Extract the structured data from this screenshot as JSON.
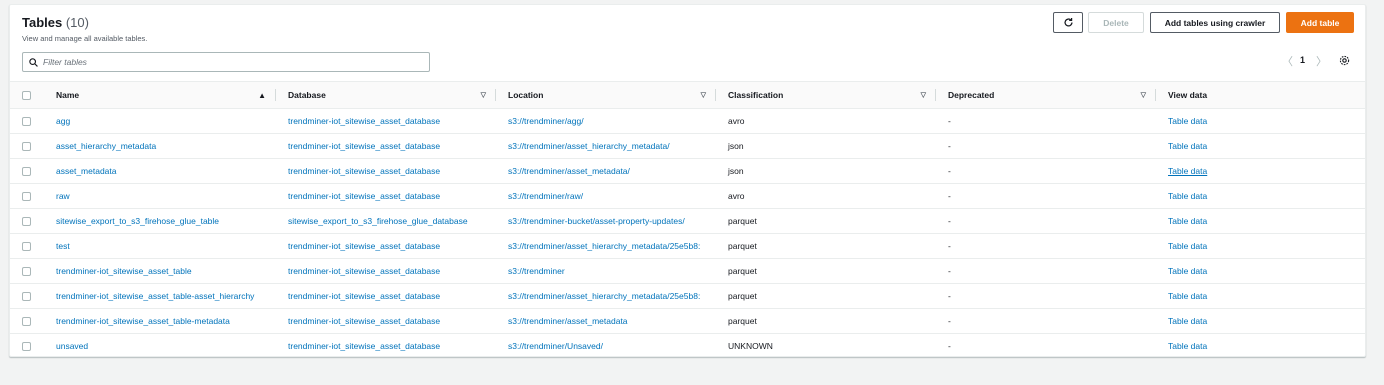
{
  "header": {
    "title": "Tables",
    "count": "(10)",
    "description": "View and manage all available tables."
  },
  "actions": {
    "delete_label": "Delete",
    "crawler_label": "Add tables using crawler",
    "add_label": "Add table"
  },
  "filter": {
    "placeholder": "Filter tables"
  },
  "pagination": {
    "prev": "〈",
    "current_page": "1",
    "next": "〉"
  },
  "columns": [
    {
      "label": "Name",
      "sort": "▲"
    },
    {
      "label": "Database",
      "sort": "▽"
    },
    {
      "label": "Location",
      "sort": "▽"
    },
    {
      "label": "Classification",
      "sort": "▽"
    },
    {
      "label": "Deprecated",
      "sort": "▽"
    },
    {
      "label": "View data",
      "sort": ""
    }
  ],
  "rows": [
    {
      "name": "agg",
      "database": "trendminer-iot_sitewise_asset_database",
      "location": "s3://trendminer/agg/",
      "classification": "avro",
      "deprecated": "-",
      "view": "Table data"
    },
    {
      "name": "asset_hierarchy_metadata",
      "database": "trendminer-iot_sitewise_asset_database",
      "location": "s3://trendminer/asset_hierarchy_metadata/",
      "classification": "json",
      "deprecated": "-",
      "view": "Table data"
    },
    {
      "name": "asset_metadata",
      "database": "trendminer-iot_sitewise_asset_database",
      "location": "s3://trendminer/asset_metadata/",
      "classification": "json",
      "deprecated": "-",
      "view": "Table data"
    },
    {
      "name": "raw",
      "database": "trendminer-iot_sitewise_asset_database",
      "location": "s3://trendminer/raw/",
      "classification": "avro",
      "deprecated": "-",
      "view": "Table data"
    },
    {
      "name": "sitewise_export_to_s3_firehose_glue_table",
      "database": "sitewise_export_to_s3_firehose_glue_database",
      "location": "s3://trendminer-bucket/asset-property-updates/",
      "classification": "parquet",
      "deprecated": "-",
      "view": "Table data"
    },
    {
      "name": "test",
      "database": "trendminer-iot_sitewise_asset_database",
      "location": "s3://trendminer/asset_hierarchy_metadata/25e5b8:",
      "classification": "parquet",
      "deprecated": "-",
      "view": "Table data"
    },
    {
      "name": "trendminer-iot_sitewise_asset_table",
      "database": "trendminer-iot_sitewise_asset_database",
      "location": "s3://trendminer",
      "classification": "parquet",
      "deprecated": "-",
      "view": "Table data"
    },
    {
      "name": "trendminer-iot_sitewise_asset_table-asset_hierarchy",
      "database": "trendminer-iot_sitewise_asset_database",
      "location": "s3://trendminer/asset_hierarchy_metadata/25e5b8:",
      "classification": "parquet",
      "deprecated": "-",
      "view": "Table data"
    },
    {
      "name": "trendminer-iot_sitewise_asset_table-metadata",
      "database": "trendminer-iot_sitewise_asset_database",
      "location": "s3://trendminer/asset_metadata",
      "classification": "parquet",
      "deprecated": "-",
      "view": "Table data"
    },
    {
      "name": "unsaved",
      "database": "trendminer-iot_sitewise_asset_database",
      "location": "s3://trendminer/Unsaved/",
      "classification": "UNKNOWN",
      "deprecated": "-",
      "view": "Table data"
    }
  ]
}
